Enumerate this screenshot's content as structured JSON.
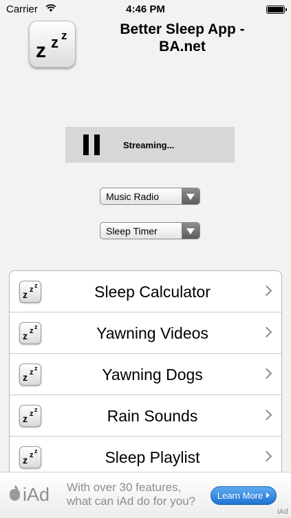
{
  "status_bar": {
    "carrier": "Carrier",
    "time": "4:46 PM"
  },
  "header": {
    "title": "Better Sleep App - BA.net",
    "icon_glyph": "z"
  },
  "player": {
    "status": "Streaming..."
  },
  "selects": {
    "music": "Music Radio",
    "timer": "Sleep Timer"
  },
  "menu": {
    "items": [
      {
        "label": "Sleep Calculator"
      },
      {
        "label": "Yawning Videos"
      },
      {
        "label": "Yawning Dogs"
      },
      {
        "label": "Rain Sounds"
      },
      {
        "label": "Sleep Playlist"
      }
    ]
  },
  "ad": {
    "brand": "iAd",
    "line1": "With over 30 features,",
    "line2": "what can iAd do for you?",
    "button": "Learn More",
    "corner": "iAd"
  },
  "colors": {
    "background": "#f4f1f1",
    "ad_button": "#2a7fd8",
    "player": "#d7d7d7"
  }
}
